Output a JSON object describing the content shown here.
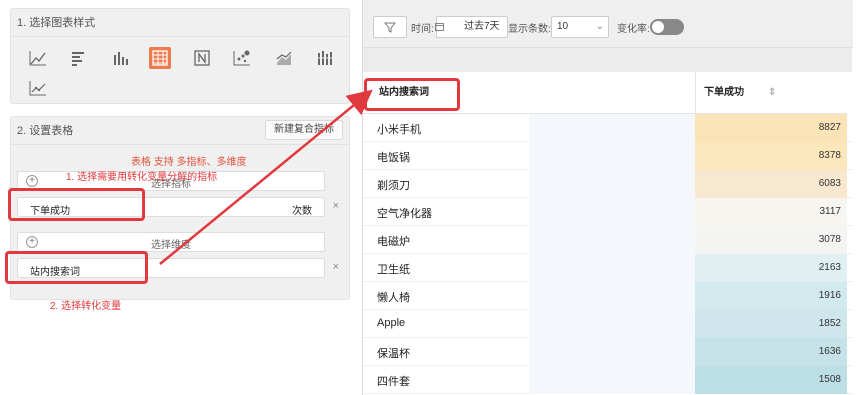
{
  "section1": {
    "title": "1. 选择图表样式"
  },
  "section2": {
    "title": "2. 设置表格",
    "new_button": "新建复合指标",
    "hint": "表格 支持 多指标、多维度",
    "metric_placeholder": "选择指标",
    "metric_value": "下单成功",
    "metric_unit": "次数",
    "dimension_placeholder": "选择维度",
    "dimension_value": "站内搜索词",
    "close_glyph": "×",
    "plus_glyph": "+"
  },
  "annotations": {
    "step1": "1. 选择需要用转化变量分解的指标",
    "step2": "2. 选择转化变量"
  },
  "toolbar": {
    "time_label": "时间:",
    "date_value": "过去7天",
    "count_label": "显示条数:",
    "count_value": "10",
    "change_label": "变化率:"
  },
  "table": {
    "col1": "站内搜索词",
    "col2": "下单成功",
    "rows": [
      {
        "name": "小米手机",
        "value": "8827",
        "color": "#fbe3b8"
      },
      {
        "name": "电饭锅",
        "value": "8378",
        "color": "#fce6bc"
      },
      {
        "name": "剃须刀",
        "value": "6083",
        "color": "#f8e8cf"
      },
      {
        "name": "空气净化器",
        "value": "3117",
        "color": "#f7f5f0"
      },
      {
        "name": "电磁炉",
        "value": "3078",
        "color": "#f4f4f2"
      },
      {
        "name": "卫生纸",
        "value": "2163",
        "color": "#dfeff2"
      },
      {
        "name": "懒人椅",
        "value": "1916",
        "color": "#d2e9ee"
      },
      {
        "name": "Apple",
        "value": "1852",
        "color": "#cfe7ec"
      },
      {
        "name": "保温杯",
        "value": "1636",
        "color": "#c5e2e8"
      },
      {
        "name": "四件套",
        "value": "1508",
        "color": "#bcdfe5"
      }
    ]
  }
}
